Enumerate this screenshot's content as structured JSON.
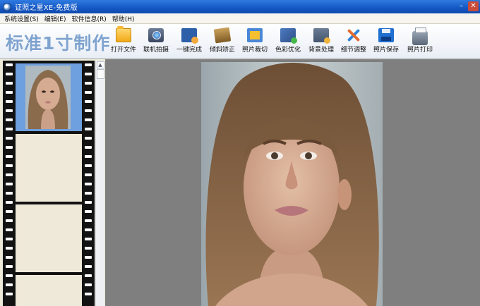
{
  "window": {
    "title": "证照之星XE-免费版"
  },
  "menu": [
    {
      "label": "系统设置(S)"
    },
    {
      "label": "编辑(E)"
    },
    {
      "label": "软件信息(R)"
    },
    {
      "label": "帮助(H)"
    }
  ],
  "brand": "标准1寸制作",
  "toolbar": {
    "open": "打开文件",
    "capture": "联机拍摄",
    "oneclick": "一键完成",
    "deskew": "倾斜矫正",
    "crop": "照片裁切",
    "color": "色彩优化",
    "background": "背景处理",
    "detail": "细节调整",
    "save": "照片保存",
    "print": "照片打印"
  },
  "colors": {
    "titlebar": "#1457c4",
    "workarea": "#7f7f7f",
    "film_selected": "#6e9fde",
    "film_empty": "#efe9da"
  }
}
